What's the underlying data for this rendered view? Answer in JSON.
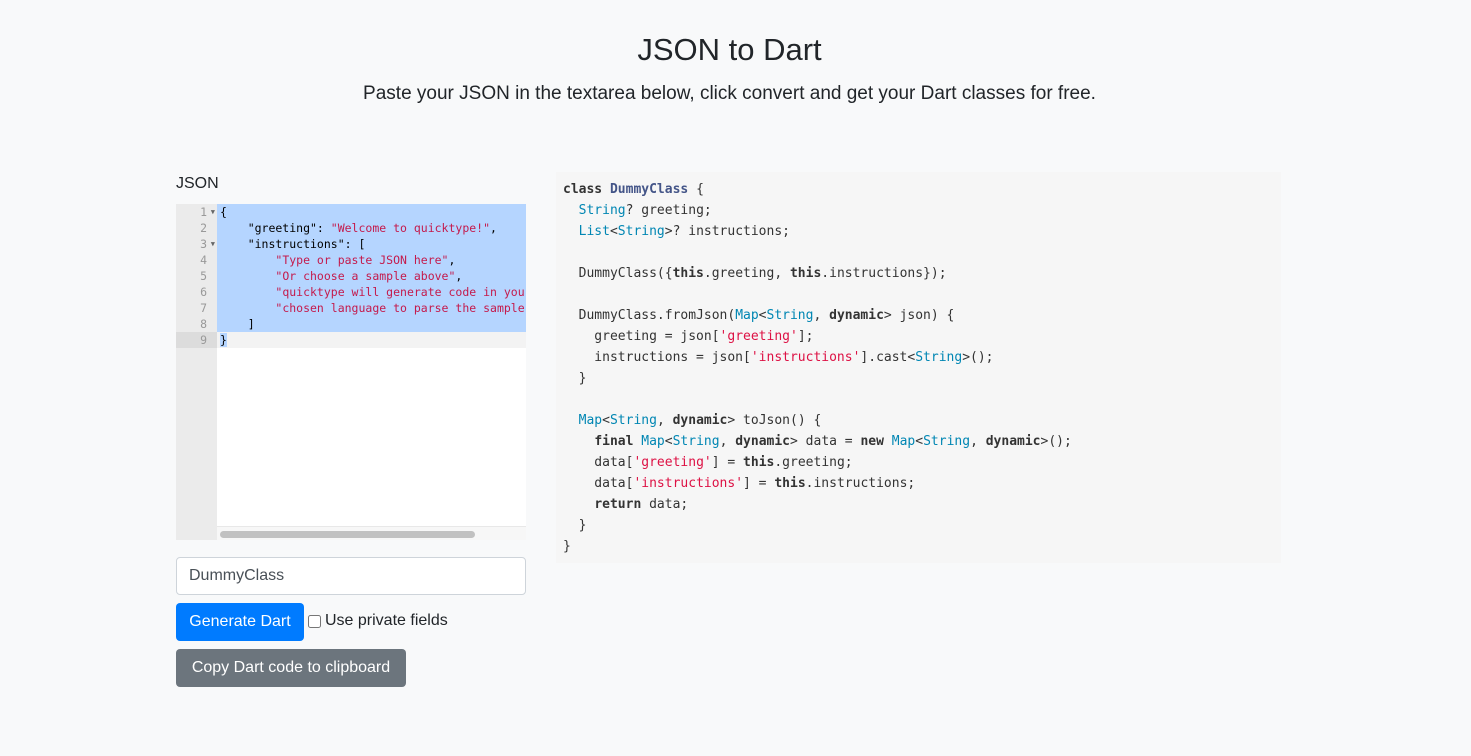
{
  "header": {
    "title": "JSON to Dart",
    "subtitle": "Paste your JSON in the textarea below, click convert and get your Dart classes for free."
  },
  "json_label": "JSON",
  "editor": {
    "line_numbers": [
      "1",
      "2",
      "3",
      "4",
      "5",
      "6",
      "7",
      "8",
      "9"
    ],
    "fold_lines": [
      1,
      3
    ],
    "lines": [
      [
        [
          "{",
          ""
        ]
      ],
      [
        [
          "    \"greeting\": ",
          ""
        ],
        [
          "\"Welcome to quicktype!\"",
          "js"
        ],
        [
          ",",
          ""
        ]
      ],
      [
        [
          "    \"instructions\": [",
          ""
        ]
      ],
      [
        [
          "        ",
          ""
        ],
        [
          "\"Type or paste JSON here\"",
          "js"
        ],
        [
          ",",
          ""
        ]
      ],
      [
        [
          "        ",
          ""
        ],
        [
          "\"Or choose a sample above\"",
          "js"
        ],
        [
          ",",
          ""
        ]
      ],
      [
        [
          "        ",
          ""
        ],
        [
          "\"quicktype will generate code in your",
          "js"
        ]
      ],
      [
        [
          "        ",
          ""
        ],
        [
          "\"chosen language to parse the sample data\"",
          "js"
        ]
      ],
      [
        [
          "    ]",
          ""
        ]
      ],
      [
        [
          "}",
          ""
        ]
      ]
    ]
  },
  "class_name_input": {
    "value": "DummyClass"
  },
  "buttons": {
    "generate": "Generate Dart",
    "copy": "Copy Dart code to clipboard"
  },
  "private_fields": {
    "label": "Use private fields",
    "checked": false
  },
  "colors": {
    "primary": "#007bff",
    "secondary": "#6c757d",
    "selection": "#b5d5ff"
  },
  "output": [
    [
      [
        "class",
        "k"
      ],
      [
        " ",
        ""
      ],
      [
        "DummyClass",
        "c"
      ],
      [
        " {",
        ""
      ]
    ],
    [
      [
        "  ",
        ""
      ],
      [
        "String",
        "t"
      ],
      [
        "? greeting;",
        ""
      ]
    ],
    [
      [
        "  ",
        ""
      ],
      [
        "List",
        "t"
      ],
      [
        "<",
        ""
      ],
      [
        "String",
        "t"
      ],
      [
        ">? instructions;",
        ""
      ]
    ],
    [
      [
        "",
        ""
      ]
    ],
    [
      [
        "  DummyClass({",
        ""
      ],
      [
        "this",
        "k"
      ],
      [
        ".greeting, ",
        ""
      ],
      [
        "this",
        "k"
      ],
      [
        ".instructions});",
        ""
      ]
    ],
    [
      [
        "",
        ""
      ]
    ],
    [
      [
        "  DummyClass.fromJson(",
        ""
      ],
      [
        "Map",
        "t"
      ],
      [
        "<",
        ""
      ],
      [
        "String",
        "t"
      ],
      [
        ", ",
        ""
      ],
      [
        "dynamic",
        "k"
      ],
      [
        "> json) {",
        ""
      ]
    ],
    [
      [
        "    greeting = json[",
        ""
      ],
      [
        "'greeting'",
        "s"
      ],
      [
        "];",
        ""
      ]
    ],
    [
      [
        "    instructions = json[",
        ""
      ],
      [
        "'instructions'",
        "s"
      ],
      [
        "].cast<",
        ""
      ],
      [
        "String",
        "t"
      ],
      [
        ">();",
        ""
      ]
    ],
    [
      [
        "  }",
        ""
      ]
    ],
    [
      [
        "",
        ""
      ]
    ],
    [
      [
        "  ",
        ""
      ],
      [
        "Map",
        "t"
      ],
      [
        "<",
        ""
      ],
      [
        "String",
        "t"
      ],
      [
        ", ",
        ""
      ],
      [
        "dynamic",
        "k"
      ],
      [
        "> toJson() {",
        ""
      ]
    ],
    [
      [
        "    ",
        ""
      ],
      [
        "final",
        "k"
      ],
      [
        " ",
        ""
      ],
      [
        "Map",
        "t"
      ],
      [
        "<",
        ""
      ],
      [
        "String",
        "t"
      ],
      [
        ", ",
        ""
      ],
      [
        "dynamic",
        "k"
      ],
      [
        "> data = ",
        ""
      ],
      [
        "new",
        "k"
      ],
      [
        " ",
        ""
      ],
      [
        "Map",
        "t"
      ],
      [
        "<",
        ""
      ],
      [
        "String",
        "t"
      ],
      [
        ", ",
        ""
      ],
      [
        "dynamic",
        "k"
      ],
      [
        ">();",
        ""
      ]
    ],
    [
      [
        "    data[",
        ""
      ],
      [
        "'greeting'",
        "s"
      ],
      [
        "] = ",
        ""
      ],
      [
        "this",
        "k"
      ],
      [
        ".greeting;",
        ""
      ]
    ],
    [
      [
        "    data[",
        ""
      ],
      [
        "'instructions'",
        "s"
      ],
      [
        "] = ",
        ""
      ],
      [
        "this",
        "k"
      ],
      [
        ".instructions;",
        ""
      ]
    ],
    [
      [
        "    ",
        ""
      ],
      [
        "return",
        "k"
      ],
      [
        " data;",
        ""
      ]
    ],
    [
      [
        "  }",
        ""
      ]
    ],
    [
      [
        "}",
        ""
      ]
    ]
  ]
}
